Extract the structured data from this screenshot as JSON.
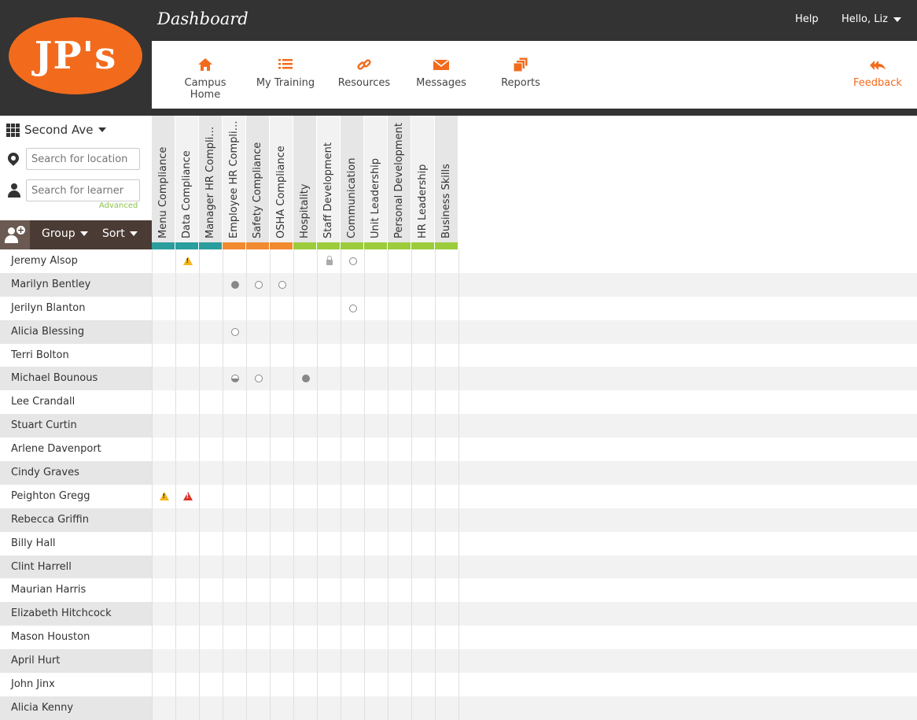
{
  "header": {
    "logo_text": "JP's",
    "title": "Dashboard",
    "help_label": "Help",
    "user_greeting": "Hello, Liz"
  },
  "nav": {
    "items": [
      {
        "label": "Campus Home",
        "icon": "home-icon"
      },
      {
        "label": "My Training",
        "icon": "list-icon"
      },
      {
        "label": "Resources",
        "icon": "link-icon"
      },
      {
        "label": "Messages",
        "icon": "envelope-icon"
      },
      {
        "label": "Reports",
        "icon": "stack-icon"
      }
    ],
    "feedback_label": "Feedback"
  },
  "sidebar": {
    "location": "Second Ave",
    "location_search_placeholder": "Search for location",
    "learner_search_placeholder": "Search for learner",
    "advanced_label": "Advanced",
    "group_label": "Group",
    "sort_label": "Sort"
  },
  "colors": {
    "brand": "#f26b1d",
    "teal": "#2a9d9d",
    "orange": "#f28a30",
    "green": "#9ccc3c",
    "warning": "#f5b51b",
    "danger": "#d9362b"
  },
  "columns": [
    {
      "label": "Menu Compliance",
      "group": "teal"
    },
    {
      "label": "Data Compliance",
      "group": "teal"
    },
    {
      "label": "Manager HR Compliance",
      "group": "teal"
    },
    {
      "label": "Employee HR Complian...",
      "group": "orange"
    },
    {
      "label": "Safety Compliance",
      "group": "orange"
    },
    {
      "label": "OSHA Compliance",
      "group": "orange"
    },
    {
      "label": "Hospitality",
      "group": "green"
    },
    {
      "label": "Staff Development",
      "group": "green"
    },
    {
      "label": "Communication",
      "group": "green"
    },
    {
      "label": "Unit Leadership",
      "group": "green"
    },
    {
      "label": "Personal Development",
      "group": "green"
    },
    {
      "label": "HR Leadership",
      "group": "green"
    },
    {
      "label": "Business Skills",
      "group": "green"
    }
  ],
  "learners": [
    {
      "name": "Jeremy Alsop",
      "marks": {
        "1": "warning",
        "7": "locked",
        "8": "open"
      }
    },
    {
      "name": "Marilyn Bentley",
      "marks": {
        "3": "complete",
        "4": "open",
        "5": "open"
      }
    },
    {
      "name": "Jerilyn Blanton",
      "marks": {
        "8": "open"
      }
    },
    {
      "name": "Alicia Blessing",
      "marks": {
        "3": "open"
      }
    },
    {
      "name": "Terri Bolton",
      "marks": {}
    },
    {
      "name": "Michael Bounous",
      "marks": {
        "3": "half",
        "4": "open",
        "6": "complete"
      }
    },
    {
      "name": "Lee Crandall",
      "marks": {}
    },
    {
      "name": "Stuart Curtin",
      "marks": {}
    },
    {
      "name": "Arlene Davenport",
      "marks": {}
    },
    {
      "name": "Cindy Graves",
      "marks": {}
    },
    {
      "name": "Peighton Gregg",
      "marks": {
        "0": "warning",
        "1": "danger"
      }
    },
    {
      "name": "Rebecca Griffin",
      "marks": {}
    },
    {
      "name": "Billy Hall",
      "marks": {}
    },
    {
      "name": "Clint Harrell",
      "marks": {}
    },
    {
      "name": "Maurian Harris",
      "marks": {}
    },
    {
      "name": "Elizabeth Hitchcock",
      "marks": {}
    },
    {
      "name": "Mason Houston",
      "marks": {}
    },
    {
      "name": "April Hurt",
      "marks": {}
    },
    {
      "name": "John Jinx",
      "marks": {}
    },
    {
      "name": "Alicia Kenny",
      "marks": {}
    }
  ]
}
